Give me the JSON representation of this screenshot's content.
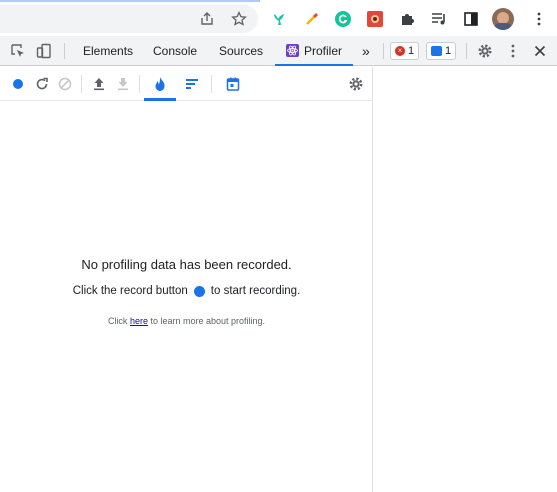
{
  "browser": {
    "toolbar_icons": [
      "share-icon",
      "star-icon",
      "bird-extension-icon",
      "eyedropper-extension-icon",
      "grammarly-extension-icon",
      "red-extension-icon",
      "puzzle-extensions-icon",
      "media-queue-icon",
      "side-panel-icon",
      "avatar",
      "kebab-menu-icon"
    ],
    "colors": {
      "omnibox": "#f1f3f4",
      "grammarly": "#15c39a",
      "red_ext": "#e3473a"
    }
  },
  "devtools": {
    "tabs": [
      {
        "label": "Elements",
        "active": false
      },
      {
        "label": "Console",
        "active": false
      },
      {
        "label": "Sources",
        "active": false
      },
      {
        "label": "Profiler",
        "active": true
      }
    ],
    "more_tabs": "»",
    "error_count": "1",
    "message_count": "1"
  },
  "profiler": {
    "toolbar_icons": [
      "record-icon",
      "reload-profile-icon",
      "clear-icon",
      "upload-icon",
      "download-icon",
      "flamegraph-icon",
      "ranked-icon",
      "timeline-icon",
      "settings-icon"
    ],
    "empty_title": "No profiling data has been recorded.",
    "empty_instruction_pre": "Click the record button",
    "empty_instruction_post": "to start recording.",
    "learn_pre": "Click",
    "learn_link": "here",
    "learn_post": "to learn more about profiling.",
    "colors": {
      "accent": "#1a73e8"
    }
  }
}
